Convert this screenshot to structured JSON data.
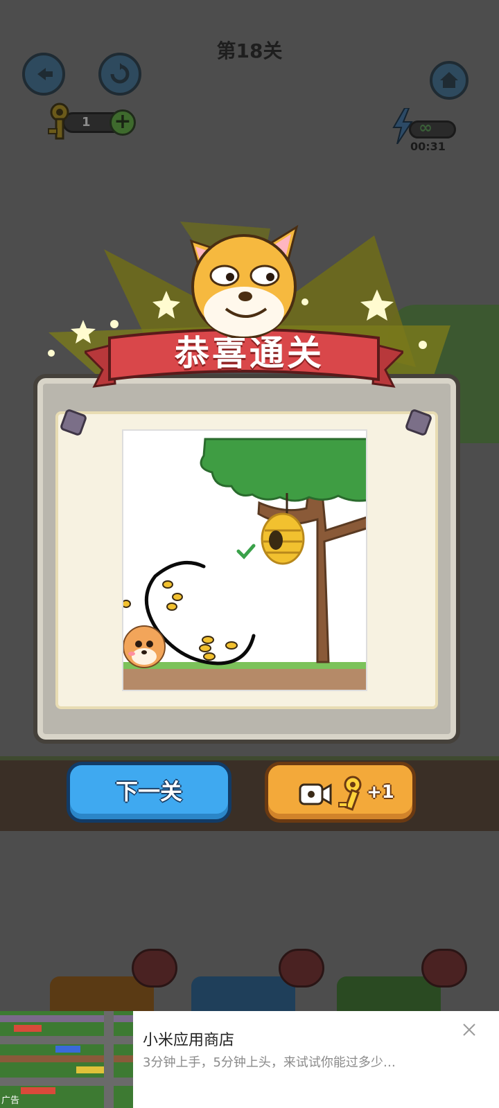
{
  "header": {
    "level_title": "第18关",
    "back_icon": "back-arrow-icon",
    "restart_icon": "restart-icon",
    "home_icon": "home-icon"
  },
  "keys": {
    "count": "1",
    "add_icon": "plus-icon"
  },
  "energy": {
    "value": "∞",
    "timer": "00:31"
  },
  "dialog": {
    "title": "恭喜通关"
  },
  "buttons": {
    "next_level": "下一关",
    "ad_key_reward": "+1"
  },
  "ad": {
    "title": "小米应用商店",
    "description": "3分钟上手，5分钟上头，来试试你能过多少…",
    "tag": "广告"
  },
  "colors": {
    "ribbon": "#d9474a",
    "next_button": "#3fa9f0",
    "reward_button": "#f3a93a"
  }
}
